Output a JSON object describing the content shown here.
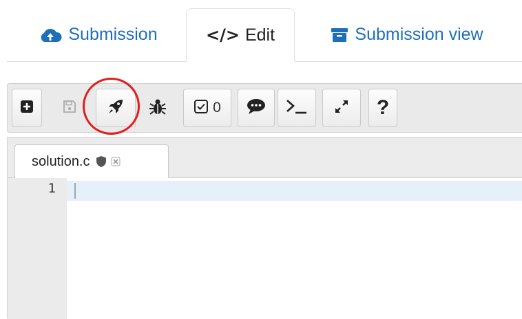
{
  "tabs": [
    {
      "label": "Submission",
      "icon": "cloud-upload-icon",
      "active": false
    },
    {
      "label": "Edit",
      "icon": "code-icon",
      "active": true
    },
    {
      "label": "Submission view",
      "icon": "archive-icon",
      "active": false
    }
  ],
  "toolbar": {
    "buttons": [
      {
        "name": "new-file",
        "icon": "plus-square-icon"
      },
      {
        "name": "save",
        "icon": "floppy-disk-icon",
        "disabled": true
      },
      {
        "name": "run",
        "icon": "rocket-icon",
        "highlighted": true
      },
      {
        "name": "debug",
        "icon": "bug-icon"
      },
      {
        "name": "tests",
        "icon": "checkbox-icon",
        "count": "0"
      },
      {
        "name": "comments",
        "icon": "speech-bubble-icon"
      },
      {
        "name": "console",
        "icon": "terminal-icon"
      },
      {
        "name": "fullscreen",
        "icon": "expand-icon"
      },
      {
        "name": "help",
        "icon": "question-icon",
        "label": "?"
      }
    ]
  },
  "editor": {
    "file_tab": {
      "label": "solution.c",
      "icons": [
        "shield-icon",
        "close-icon"
      ]
    },
    "line_numbers": [
      "1"
    ]
  },
  "colors": {
    "link_blue": "#1e6fb8",
    "highlight_red": "#e11d1d",
    "active_line": "#e6f0fb"
  }
}
